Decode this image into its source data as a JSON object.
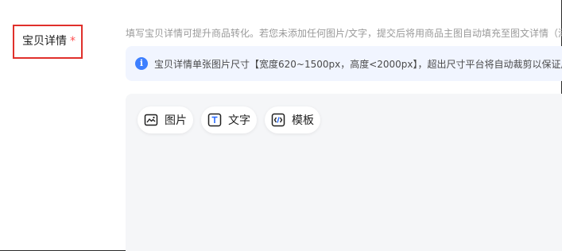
{
  "field": {
    "label": "宝贝详情",
    "required_mark": "*"
  },
  "hint": "填写宝贝详情可提升商品转化。若您未添加任何图片/文字，提交后将用商品主图自动填充至图文详情（添",
  "notice": {
    "icon": "info-icon",
    "text": "宝贝详情单张图片尺寸【宽度620~1500px，高度<2000px】，超出尺寸平台将自动裁剪以保证展"
  },
  "toolbar": {
    "image_label": "图片",
    "text_label": "文字",
    "template_label": "模板"
  },
  "colors": {
    "required": "#ff4d4f",
    "highlight_border": "#e0302b",
    "notice_bg": "#f1f5ff",
    "info_icon": "#3d7fff",
    "editor_bg": "#f5f6f8"
  }
}
